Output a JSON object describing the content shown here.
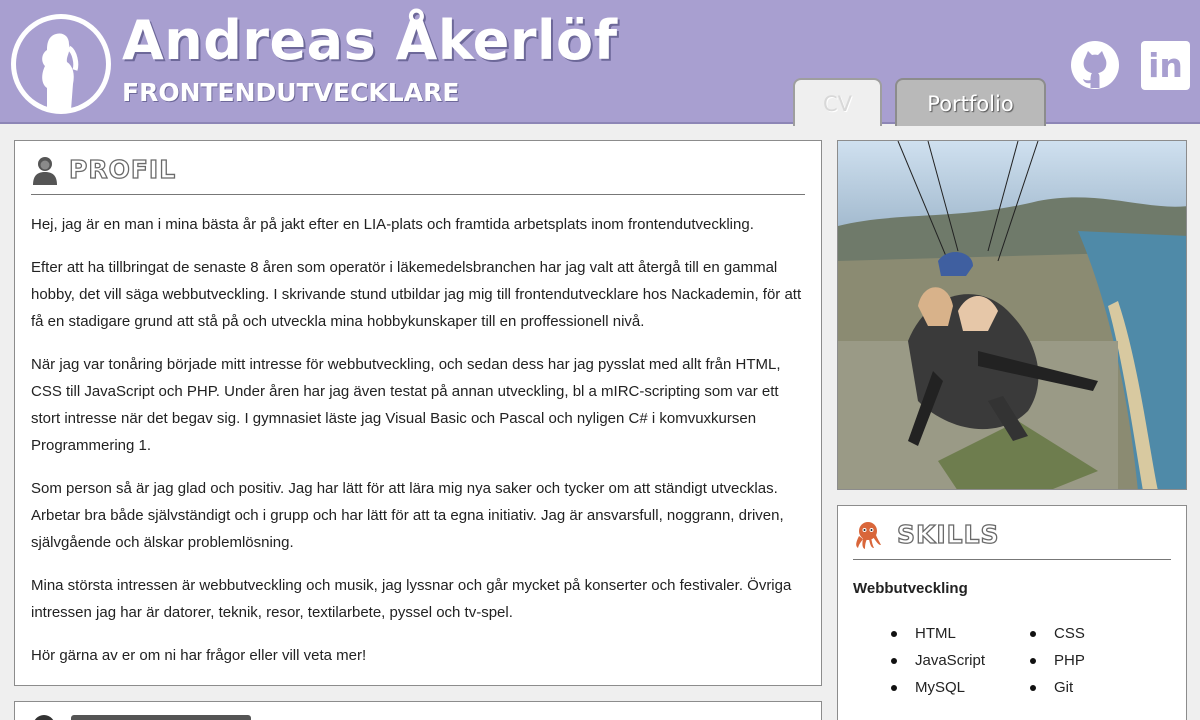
{
  "header": {
    "name": "Andreas Åkerlöf",
    "role": "FRONTENDUTVECKLARE",
    "links": [
      {
        "label": "GitHub",
        "icon": "github-icon"
      },
      {
        "label": "in",
        "icon": "linkedin-icon"
      }
    ],
    "tabs": [
      {
        "label": "CV",
        "active": true
      },
      {
        "label": "Portfolio",
        "active": false
      }
    ]
  },
  "profile": {
    "title": "PROFIL",
    "icon": "person-icon",
    "paragraphs": [
      "Hej, jag är en man i mina bästa år på jakt efter en LIA-plats och framtida arbetsplats inom frontendutveckling.",
      "Efter att ha tillbringat de senaste 8 åren som operatör i läkemedelsbranchen har jag valt att återgå till en gammal hobby, det vill säga webbutveckling. I skrivande stund utbildar jag mig till frontendutvecklare hos Nackademin, för att få en stadigare grund att stå på och utveckla mina hobbykunskaper till en proffessionell nivå.",
      "När jag var tonåring började mitt intresse för webbutveckling, och sedan dess har jag pysslat med allt från HTML, CSS till JavaScript och PHP. Under åren har jag även testat på annan utveckling, bl a mIRC-scripting som var ett stort intresse när det begav sig. I gymnasiet läste jag Visual Basic och Pascal och nyligen C# i komvuxkursen Programmering 1.",
      "Som person så är jag glad och positiv. Jag har lätt för att lära mig nya saker och tycker om att ständigt utvecklas. Arbetar bra både självständigt och i grupp och har lätt för att ta egna initiativ. Jag är ansvarsfull, noggrann, driven, självgående och älskar problemlösning.",
      "Mina största intressen är webbutveckling och musik, jag lyssnar och går mycket på konserter och festivaler. Övriga intressen jag har är datorer, teknik, resor, textilarbete, pyssel och tv-spel.",
      "Hör gärna av er om ni har frågor eller vill veta mer!"
    ]
  },
  "skills": {
    "title": "SKILLS",
    "icon": "octopus-icon",
    "category": "Webbutveckling",
    "col1": [
      "HTML",
      "JavaScript",
      "MySQL"
    ],
    "col2": [
      "CSS",
      "PHP",
      "Git"
    ]
  },
  "photo": {
    "icon": "paragliding-photo"
  },
  "colors": {
    "header_bg": "#a89fd0",
    "skills_icon": "#d9663a",
    "page_bg": "#efefef"
  }
}
